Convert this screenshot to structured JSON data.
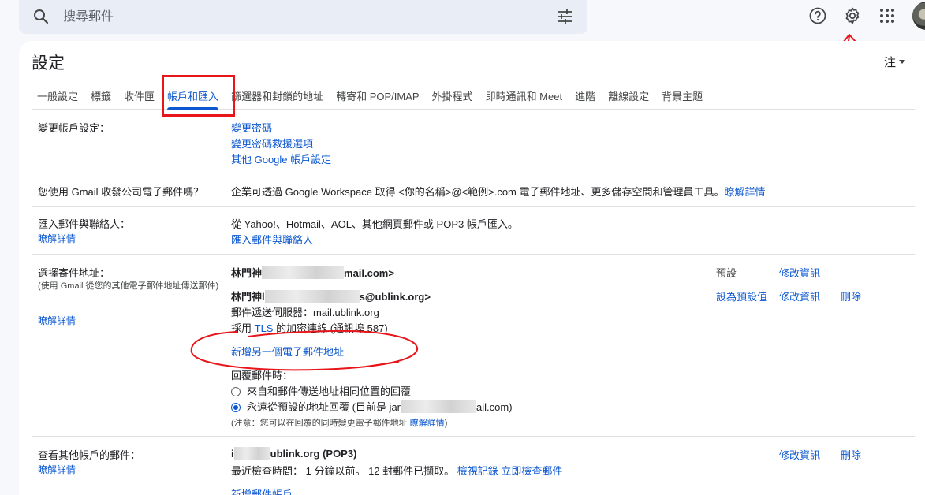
{
  "search": {
    "placeholder": "搜尋郵件"
  },
  "header": {
    "title": "設定",
    "language": "注"
  },
  "tabs": [
    {
      "label": "一般設定"
    },
    {
      "label": "標籤"
    },
    {
      "label": "收件匣"
    },
    {
      "label": "帳戶和匯入"
    },
    {
      "label": "篩選器和封鎖的地址"
    },
    {
      "label": "轉寄和 POP/IMAP"
    },
    {
      "label": "外掛程式"
    },
    {
      "label": "即時通訊和 Meet"
    },
    {
      "label": "進階"
    },
    {
      "label": "離線設定"
    },
    {
      "label": "背景主題"
    }
  ],
  "active_tab": "帳戶和匯入",
  "sections": {
    "change_account": {
      "label": "變更帳戶設定：",
      "links": [
        "變更密碼",
        "變更密碼救援選項",
        "其他 Google 帳戶設定"
      ]
    },
    "workspace": {
      "label": "您使用 Gmail 收發公司電子郵件嗎？",
      "text": "企業可透過 Google Workspace 取得 <你的名稱>@<範例>.com 電子郵件地址、更多儲存空間和管理員工具。",
      "link": "瞭解詳情"
    },
    "import": {
      "label": "匯入郵件與聯絡人：",
      "learn": "瞭解詳情",
      "text": "從 Yahoo!、Hotmail、AOL、其他網頁郵件或 POP3 帳戶匯入。",
      "link": "匯入郵件與聯絡人"
    },
    "send_as": {
      "label": "選擇寄件地址：",
      "note": "(使用 Gmail 從您的其他電子郵件地址傳送郵件)",
      "learn": "瞭解詳情",
      "addr1_prefix": "林門神",
      "addr1_suffix": "mail.com>",
      "addr1_status": "預設",
      "addr1_edit": "修改資訊",
      "addr2_prefix": "林門神l",
      "addr2_suffix": "s@ublink.org>",
      "addr2_server": "郵件遞送伺服器：mail.ublink.org",
      "addr2_tls_pre": "採用 ",
      "addr2_tls_link": "TLS",
      "addr2_tls_post": " 的加密連線 (通訊埠 587)",
      "addr2_default": "設為預設值",
      "addr2_edit": "修改資訊",
      "addr2_delete": "刪除",
      "add_another": "新增另一個電子郵件地址",
      "reply_label": "回覆郵件時：",
      "reply_opt1": "來自和郵件傳送地址相同位置的回覆",
      "reply_opt2_pre": "永遠從預設的地址回覆 (目前是 jar",
      "reply_opt2_post": "ail.com)",
      "reply_note": "(注意：您可以在回覆的同時變更電子郵件地址 ",
      "reply_note_link": "瞭解詳情",
      "reply_note_end": ")"
    },
    "check_mail": {
      "label": "查看其他帳戶的郵件：",
      "learn": "瞭解詳情",
      "account_prefix": "i",
      "account_suffix": "ublink.org (POP3)",
      "last_check": "最近檢查時間： 1 分鐘以前。 12 封郵件已擷取。",
      "history": "檢視記錄",
      "check_now": "立即檢查郵件",
      "edit": "修改資訊",
      "delete": "刪除",
      "add_account": "新增郵件帳戶"
    }
  },
  "annotation_color": "#e8151b",
  "accent_color": "#0b57d0"
}
